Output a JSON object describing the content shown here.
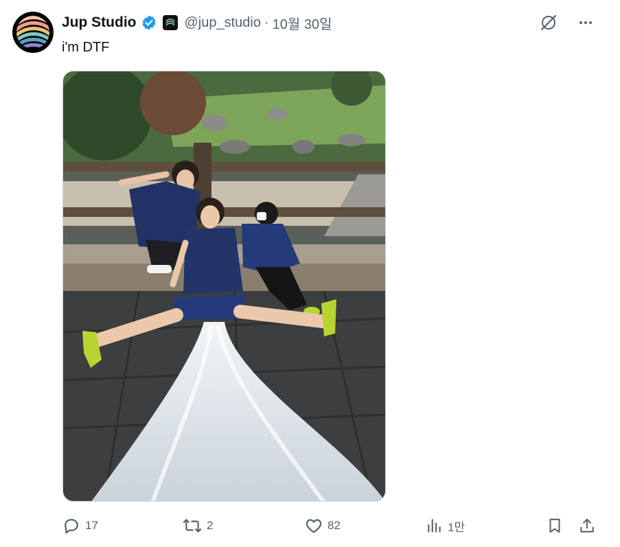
{
  "post": {
    "author": {
      "display_name": "Jup Studio",
      "handle": "@jup_studio",
      "verified": true,
      "avatar_icon": "rainbow-logo-icon",
      "affiliate_icon": "affiliate-badge-icon"
    },
    "separator": "·",
    "time": "10월 30일",
    "text": "i'm DTF",
    "media_alt_icon": "photo",
    "actions": {
      "replies": "17",
      "reposts": "2",
      "likes": "82",
      "views": "1만"
    }
  },
  "colors": {
    "text": "#0f1419",
    "secondary": "#536471",
    "verified": "#1d9bf0",
    "border": "#cfd9de"
  }
}
